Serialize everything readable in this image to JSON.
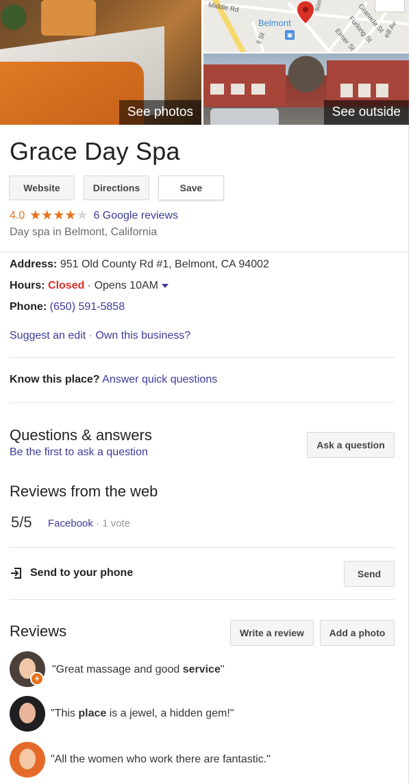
{
  "hero": {
    "photos_label": "See photos",
    "outside_label": "See outside",
    "map": {
      "city": "Belmont",
      "streets": [
        "Middle Rd",
        "Granada St",
        "Furlong St",
        "Elmer St",
        "ll St",
        "son",
        "eill Av"
      ]
    }
  },
  "business": {
    "name": "Grace Day Spa",
    "buttons": {
      "website": "Website",
      "directions": "Directions",
      "save": "Save"
    },
    "rating": "4.0",
    "rating_stars": 4,
    "reviews_link": "6 Google reviews",
    "category": "Day spa in Belmont, California"
  },
  "details": {
    "address_label": "Address:",
    "address_value": "951 Old County Rd #1, Belmont, CA 94002",
    "hours_label": "Hours:",
    "hours_status": "Closed",
    "hours_sep": " · ",
    "hours_opens": "Opens 10AM",
    "phone_label": "Phone:",
    "phone_value": "(650) 591-5858",
    "suggest_edit": "Suggest an edit",
    "edit_sep": " · ",
    "own_business": "Own this business?"
  },
  "know_place": {
    "label": "Know this place?",
    "link": "Answer quick questions"
  },
  "qa": {
    "title": "Questions & answers",
    "subtitle": "Be the first to ask a question",
    "ask_button": "Ask a question"
  },
  "web_reviews": {
    "title": "Reviews from the web",
    "score": "5/5",
    "source": "Facebook",
    "votes": " · 1 vote"
  },
  "send_to_phone": {
    "label": "Send to your phone",
    "button": "Send"
  },
  "reviews": {
    "title": "Reviews",
    "write_button": "Write a review",
    "photo_button": "Add a photo",
    "items": [
      {
        "before": "\"Great massage and good ",
        "bold": "service",
        "after": "\""
      },
      {
        "before": "\"This ",
        "bold": "place",
        "after": " is a jewel, a hidden gem!\""
      },
      {
        "before": "\"All the women who work there are fantastic.\"",
        "bold": "",
        "after": ""
      }
    ]
  },
  "colors": {
    "star": "#e7711b",
    "link": "#3b3b9a",
    "closed": "#d93025"
  }
}
